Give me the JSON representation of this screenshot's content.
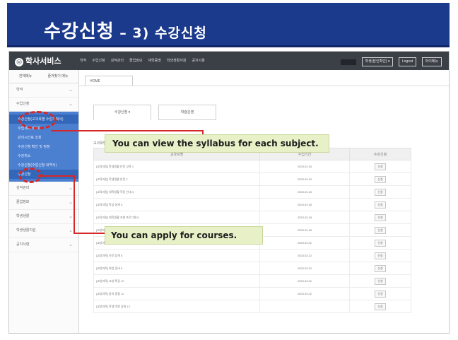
{
  "slide": {
    "title_main": "수강신청",
    "title_dash": " – ",
    "title_sub": "3) 수강신청"
  },
  "app": {
    "brand": "학사서비스",
    "logo_glyph": "◎",
    "top_menu": [
      "학적",
      "수업신청",
      "성적관리",
      "졸업정보",
      "재학증명",
      "학생생활지원",
      "공지사항"
    ],
    "top_right": {
      "user_label": "학생(본인확인) ▾",
      "logout_label": "Logout",
      "mypage_label": "마이메뉴"
    }
  },
  "sidebar": {
    "tabs": [
      "전체메뉴",
      "즐겨찾기 메뉴"
    ],
    "items_before": [
      {
        "label": "학적"
      },
      {
        "label": "수업신청"
      }
    ],
    "submenu": [
      {
        "label": "수강신청(교과목별 수업계획서)",
        "selected": true
      },
      {
        "label": "수업계획서조회"
      },
      {
        "label": "강의시간표 조회"
      },
      {
        "label": "수강신청 확인 및 정정"
      },
      {
        "label": "수강취소"
      },
      {
        "label": "수강신청(수업신청 내역서)"
      },
      {
        "label": "수강신청",
        "selected": true
      }
    ],
    "items_after": [
      {
        "label": "성적관리"
      },
      {
        "label": "졸업정보"
      },
      {
        "label": "학생생활"
      },
      {
        "label": "학생생활지원"
      },
      {
        "label": "공지사항"
      }
    ],
    "chevron": "⌄"
  },
  "content": {
    "page_tab": "HOME",
    "inner_tabs": [
      "수강신청 ▾",
      "학습운영"
    ],
    "section_label": "교과목명 및 수업시간",
    "table_headers": [
      "교과목명",
      "수업기간",
      "수강신청"
    ],
    "rows": [
      {
        "name": "[교육과정] 학생생활 안전 교육 1",
        "date": "2023.03.15",
        "action": "신청"
      },
      {
        "name": "[교육과정] 학생생활 안전 2",
        "date": "2023.03.15",
        "action": "신청"
      },
      {
        "name": "[교육과정] 대학생활 적응 안내 3",
        "date": "2023.03.15",
        "action": "신청"
      },
      {
        "name": "[교육과정] 학업 설계 4",
        "date": "2023.03.18",
        "action": "신청"
      },
      {
        "name": "[교육과정] 대학생활 지원 프로그램 5",
        "date": "2023.03.18",
        "action": "신청"
      },
      {
        "name": "[교양과목] 자기계발 6",
        "date": "2023.03.18",
        "action": "신청"
      },
      {
        "name": "[교양과목] 리더십 7",
        "date": "2023.03.22",
        "action": "신청"
      },
      {
        "name": "[교양과목] 진로 탐색 8",
        "date": "2023.03.22",
        "action": "신청"
      },
      {
        "name": "[교양과목] 취업 준비 9",
        "date": "2023.03.22",
        "action": "신청"
      },
      {
        "name": "[교양과목] 교양 특강 10",
        "date": "2023.03.22",
        "action": "신청"
      },
      {
        "name": "[교양과목] 창의 융합 11",
        "date": "2023.03.22",
        "action": "신청"
      },
      {
        "name": "[교양과목] 학생 역량 강화 12",
        "date": "",
        "action": "신청"
      }
    ]
  },
  "callouts": {
    "syllabus": "You can view the syllabus for each subject.",
    "apply": "You can apply for courses."
  },
  "colors": {
    "header_blue": "#1b3a8c",
    "submenu_blue": "#4b7fcf",
    "callout_bg": "#e8f0c8",
    "annotation_red": "#d62828"
  }
}
